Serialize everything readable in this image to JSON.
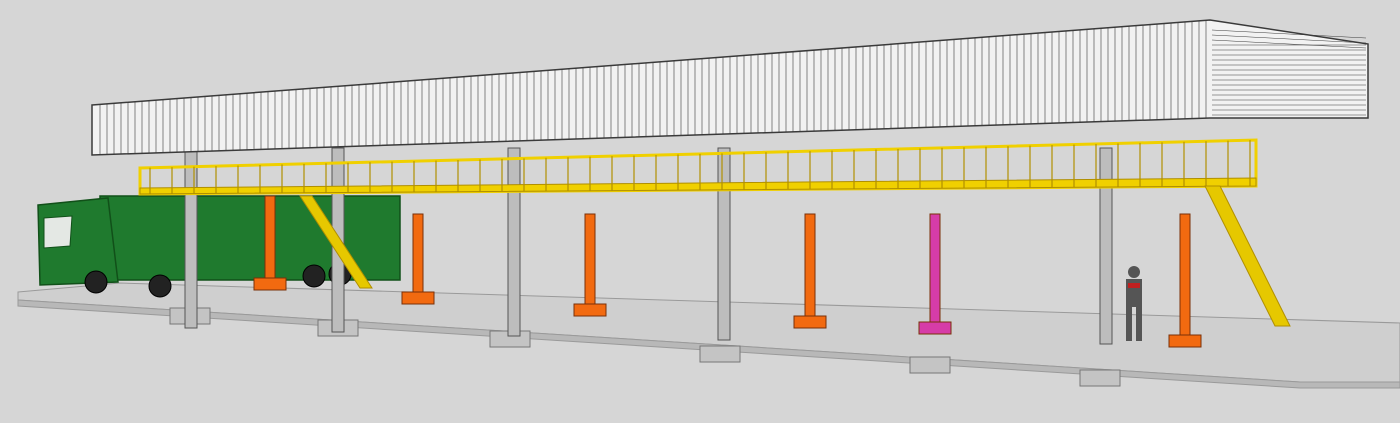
{
  "scene": {
    "subject": "",
    "colors": {
      "background": "#d6d6d6",
      "slab": "#cfcfcf",
      "slab_edge": "#9a9a9a",
      "roof": "#f2f2f2",
      "roof_line": "#3a3a3a",
      "steel": "#bdbdbd",
      "walkway": "#f0d000",
      "walkway_dark": "#b08f00",
      "stair": "#e6c800",
      "support_orange": "#f26a10",
      "support_magenta": "#d63ca8",
      "truck_green": "#1f7a2e",
      "truck_dark": "#115019",
      "wheel": "#222222",
      "person": "#555555",
      "person_accent": "#c02020"
    }
  }
}
